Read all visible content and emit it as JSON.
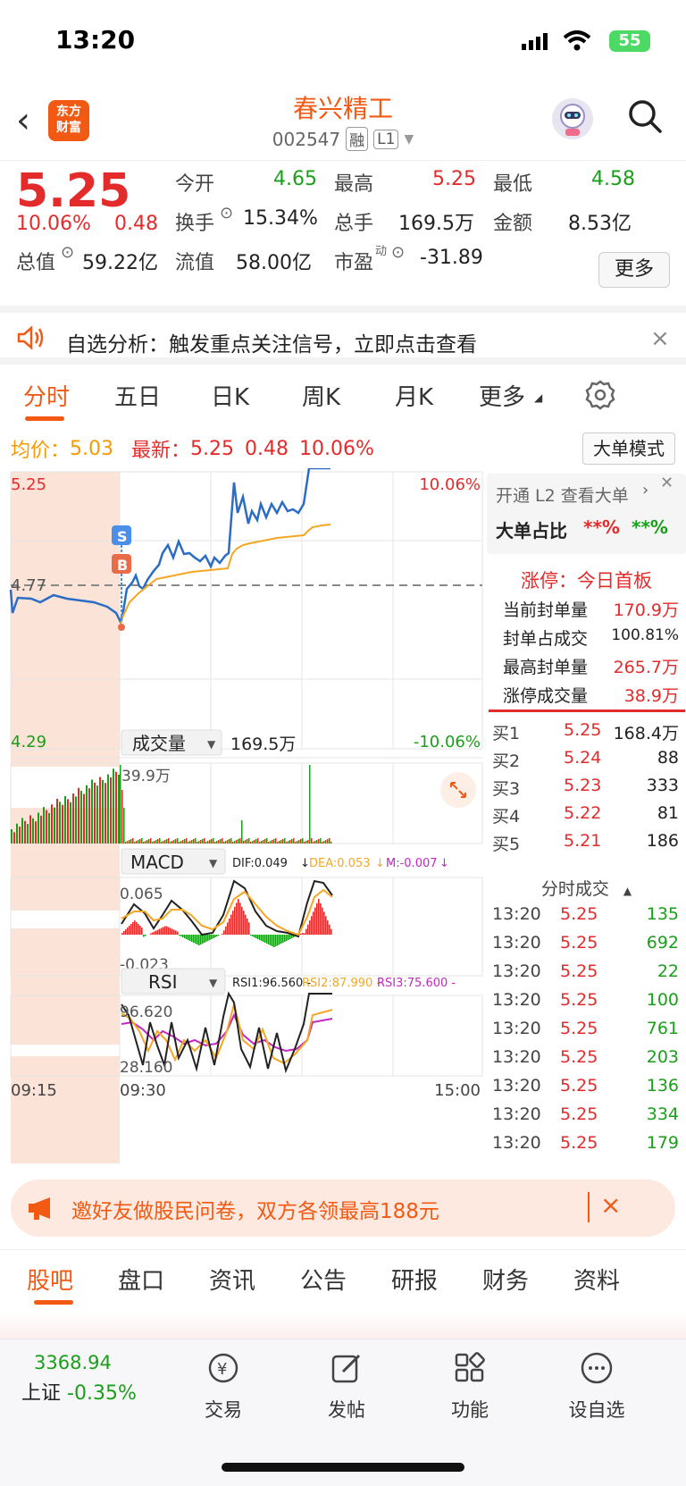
{
  "status": {
    "time": "13:20",
    "battery": "55"
  },
  "header": {
    "back": "‹",
    "brand_logo_lines": [
      "东方",
      "财富"
    ],
    "stock_name": "春兴精工",
    "stock_code": "002547",
    "tag_margin": "融",
    "tag_level": "L1"
  },
  "quote": {
    "price": "5.25",
    "change_pct": "10.06%",
    "change_amt": "0.48",
    "open_label": "今开",
    "open_value": "4.65",
    "high_label": "最高",
    "high_value": "5.25",
    "low_label": "最低",
    "low_value": "4.58",
    "turnover_label": "换手",
    "turnover_value": "15.34%",
    "volume_label": "总手",
    "volume_value": "169.5万",
    "amount_label": "金额",
    "amount_value": "8.53亿",
    "mktcap_label": "总值",
    "mktcap_value": "59.22亿",
    "float_label": "流值",
    "float_value": "58.00亿",
    "pe_label": "市盈",
    "pe_sup": "动",
    "pe_value": "-31.89",
    "more_button": "更多"
  },
  "notice": {
    "text": "自选分析：触发重点关注信号，立即点击查看",
    "close": "×"
  },
  "tabs": [
    "分时",
    "五日",
    "日K",
    "周K",
    "月K",
    "更多"
  ],
  "chart_info": {
    "avg_label": "均价：",
    "avg_value": "5.03",
    "last_label": "最新：",
    "last_value": "5.25",
    "last_change": "0.48",
    "last_pct": "10.06%",
    "mode_button": "大单模式"
  },
  "chart_labels": {
    "price_top": "5.25",
    "price_mid": "4.77",
    "price_bottom": "4.29",
    "pct_top": "10.06%",
    "pct_bottom": "-10.06%",
    "volume_selector": "成交量",
    "volume_total": "169.5万",
    "volume_max": "39.9万",
    "macd_selector": "MACD",
    "dif": "DIF:0.049",
    "dea": "DEA:0.053",
    "m": "M:-0.007",
    "macd_top": "0.065",
    "macd_bottom": "-0.023",
    "rsi_selector": "RSI",
    "rsi1": "RSI1:96.560 -",
    "rsi2": "RSI2:87.990 -",
    "rsi3": "RSI3:75.600 -",
    "rsi_top": "96.620",
    "rsi_bottom": "28.160",
    "time_start": "09:15",
    "time_open": "09:30",
    "time_end": "15:00",
    "marker_s": "S",
    "marker_b": "B"
  },
  "right_panel": {
    "l2_link": "开通 L2 查看大单",
    "big_ratio_label": "大单占比",
    "big_ratio_1": "**%",
    "big_ratio_2": "**%",
    "limit_title": "涨停：今日首板",
    "seal_amount_label": "当前封单量",
    "seal_amount_value": "170.9万",
    "seal_ratio_label": "封单占成交",
    "seal_ratio_value": "100.81%",
    "max_seal_label": "最高封单量",
    "max_seal_value": "265.7万",
    "limit_vol_label": "涨停成交量",
    "limit_vol_value": "38.9万",
    "bids": [
      {
        "label": "买1",
        "price": "5.25",
        "vol": "168.4万"
      },
      {
        "label": "买2",
        "price": "5.24",
        "vol": "88"
      },
      {
        "label": "买3",
        "price": "5.23",
        "vol": "333"
      },
      {
        "label": "买4",
        "price": "5.22",
        "vol": "81"
      },
      {
        "label": "买5",
        "price": "5.21",
        "vol": "186"
      }
    ],
    "ticks_title": "分时成交",
    "ticks": [
      {
        "time": "13:20",
        "price": "5.25",
        "vol": "135"
      },
      {
        "time": "13:20",
        "price": "5.25",
        "vol": "692"
      },
      {
        "time": "13:20",
        "price": "5.25",
        "vol": "22"
      },
      {
        "time": "13:20",
        "price": "5.25",
        "vol": "100"
      },
      {
        "time": "13:20",
        "price": "5.25",
        "vol": "761"
      },
      {
        "time": "13:20",
        "price": "5.25",
        "vol": "203"
      },
      {
        "time": "13:20",
        "price": "5.25",
        "vol": "136"
      },
      {
        "time": "13:20",
        "price": "5.25",
        "vol": "334"
      },
      {
        "time": "13:20",
        "price": "5.25",
        "vol": "179"
      }
    ]
  },
  "banner": {
    "text": "邀好友做股民问卷，双方各领最高188元",
    "close": "×"
  },
  "bottom_tabs": [
    "股吧",
    "盘口",
    "资讯",
    "公告",
    "研报",
    "财务",
    "资料"
  ],
  "bottom_bar": {
    "index_value": "3368.94",
    "index_name": "上证",
    "index_change": "-0.35%",
    "items": [
      "交易",
      "发帖",
      "功能",
      "设自选"
    ]
  },
  "colors": {
    "up": "#e42b2b",
    "down": "#1a9f1a",
    "brand": "#f25a14",
    "avg_line": "#f5a623",
    "price_line": "#2b6cc4"
  }
}
